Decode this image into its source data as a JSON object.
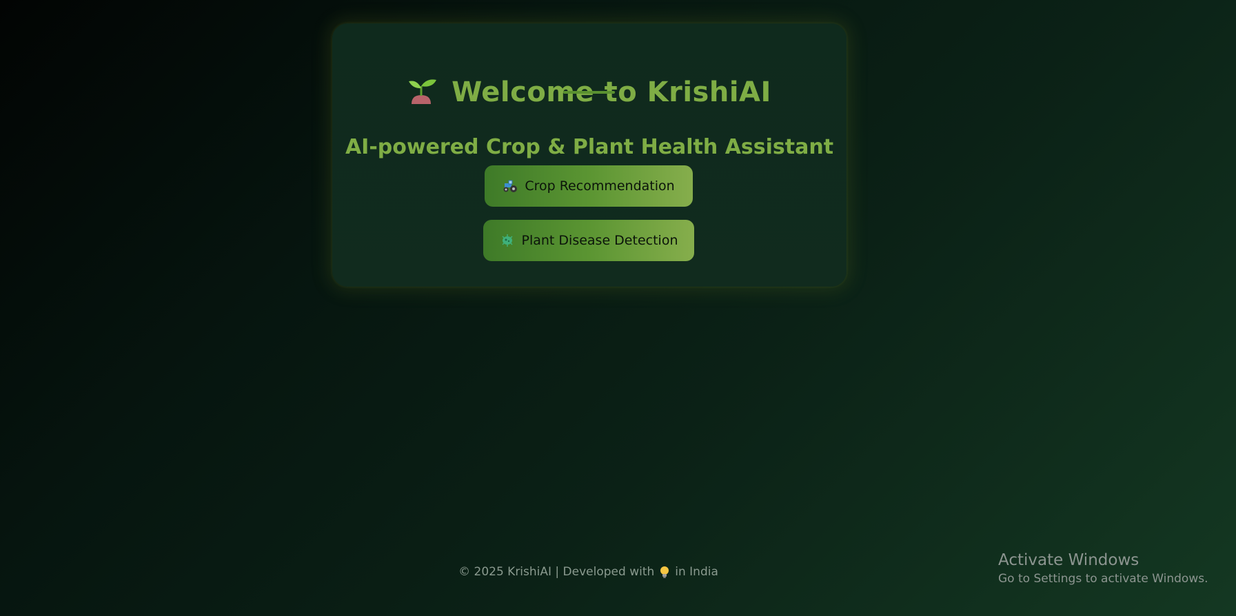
{
  "card": {
    "title": "Welcome to KrishiAI",
    "title_icon": "sprout-icon",
    "subtitle": "AI-powered Crop & Plant Health Assistant"
  },
  "buttons": {
    "crop": {
      "label": "Crop Recommendation",
      "icon": "tractor-icon"
    },
    "disease": {
      "label": "Plant Disease Detection",
      "icon": "microbe-icon"
    }
  },
  "footer": {
    "prefix": "© 2025 KrishiAI | Developed with",
    "icon": "lightbulb-icon",
    "suffix": "in India"
  },
  "watermark": {
    "title": "Activate Windows",
    "subtitle": "Go to Settings to activate Windows."
  },
  "colors": {
    "accent": "#7fad45",
    "button_start": "#3e7a28",
    "button_end": "#86ae4c",
    "background_dark": "#020403",
    "background_light": "#143822"
  }
}
